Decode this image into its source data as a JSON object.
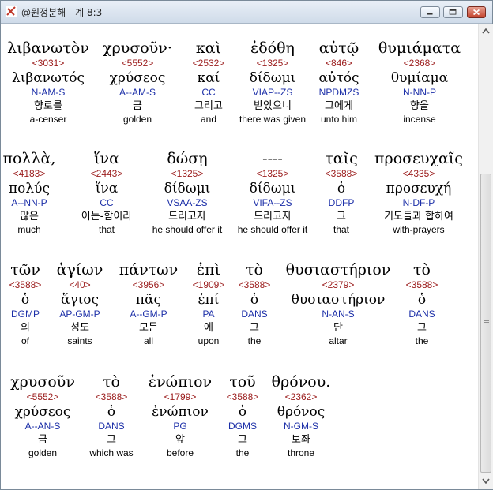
{
  "window": {
    "title": "@원정분해 - 계 8:3",
    "buttons": [
      "minimize",
      "maximize",
      "close"
    ]
  },
  "verse": {
    "rows": [
      [
        {
          "greek": "λιβανωτὸν",
          "strong": "<3031>",
          "lemma": "λιβανωτός",
          "parsing": "N-AM-S",
          "korean": "향로를",
          "english": "a-censer"
        },
        {
          "greek": "χρυσοῦν·",
          "strong": "<5552>",
          "lemma": "χρύσεος",
          "parsing": "A--AM-S",
          "korean": "금",
          "english": "golden"
        },
        {
          "greek": "καὶ",
          "strong": "<2532>",
          "lemma": "καί",
          "parsing": "CC",
          "korean": "그리고",
          "english": "and"
        },
        {
          "greek": "ἐδόθη",
          "strong": "<1325>",
          "lemma": "δίδωμι",
          "parsing": "VIAP--ZS",
          "korean": "받았으니",
          "english": "there was given"
        },
        {
          "greek": "αὐτῷ",
          "strong": "<846>",
          "lemma": "αὐτός",
          "parsing": "NPDMZS",
          "korean": "그에게",
          "english": "unto him"
        },
        {
          "greek": "θυμιάματα",
          "strong": "<2368>",
          "lemma": "θυμίαμα",
          "parsing": "N-NN-P",
          "korean": "향을",
          "english": "incense"
        }
      ],
      [
        {
          "greek": "πολλὰ,",
          "strong": "<4183>",
          "lemma": "πολύς",
          "parsing": "A--NN-P",
          "korean": "많은",
          "english": "much"
        },
        {
          "greek": "ἵνα",
          "strong": "<2443>",
          "lemma": "ἵνα",
          "parsing": "CC",
          "korean": "이는-함이라",
          "english": "that"
        },
        {
          "greek": "δώσῃ",
          "strong": "<1325>",
          "lemma": "δίδωμι",
          "parsing": "VSAA-ZS",
          "korean": "드리고자",
          "english": "he should offer it"
        },
        {
          "greek": "----",
          "strong": "<1325>",
          "lemma": "δίδωμι",
          "parsing": "VIFA--ZS",
          "korean": "드리고자",
          "english": "he should offer it"
        },
        {
          "greek": "ταῖς",
          "strong": "<3588>",
          "lemma": "ὁ",
          "parsing": "DDFP",
          "korean": "그",
          "english": "that"
        },
        {
          "greek": "προσευχαῖς",
          "strong": "<4335>",
          "lemma": "προσευχή",
          "parsing": "N-DF-P",
          "korean": "기도들과 합하여",
          "english": "with-prayers"
        }
      ],
      [
        {
          "greek": "τῶν",
          "strong": "<3588>",
          "lemma": "ὁ",
          "parsing": "DGMP",
          "korean": "의",
          "english": "of"
        },
        {
          "greek": "ἁγίων",
          "strong": "<40>",
          "lemma": "ἅγιος",
          "parsing": "AP-GM-P",
          "korean": "성도",
          "english": "saints"
        },
        {
          "greek": "πάντων",
          "strong": "<3956>",
          "lemma": "πᾶς",
          "parsing": "A--GM-P",
          "korean": "모든",
          "english": "all"
        },
        {
          "greek": "ἐπὶ",
          "strong": "<1909>",
          "lemma": "ἐπί",
          "parsing": "PA",
          "korean": "에",
          "english": "upon"
        },
        {
          "greek": "τὸ",
          "strong": "<3588>",
          "lemma": "ὁ",
          "parsing": "DANS",
          "korean": "그",
          "english": "the"
        },
        {
          "greek": "θυσιαστήριον",
          "strong": "<2379>",
          "lemma": "θυσιαστήριον",
          "parsing": "N-AN-S",
          "korean": "단",
          "english": "altar"
        },
        {
          "greek": "τὸ",
          "strong": "<3588>",
          "lemma": "ὁ",
          "parsing": "DANS",
          "korean": "그",
          "english": "the"
        }
      ],
      [
        {
          "greek": "χρυσοῦν",
          "strong": "<5552>",
          "lemma": "χρύσεος",
          "parsing": "A--AN-S",
          "korean": "금",
          "english": "golden"
        },
        {
          "greek": "τὸ",
          "strong": "<3588>",
          "lemma": "ὁ",
          "parsing": "DANS",
          "korean": "그",
          "english": "which was"
        },
        {
          "greek": "ἐνώπιον",
          "strong": "<1799>",
          "lemma": "ἐνώπιον",
          "parsing": "PG",
          "korean": "앞",
          "english": "before"
        },
        {
          "greek": "τοῦ",
          "strong": "<3588>",
          "lemma": "ὁ",
          "parsing": "DGMS",
          "korean": "그",
          "english": "the"
        },
        {
          "greek": "θρόνου.",
          "strong": "<2362>",
          "lemma": "θρόνος",
          "parsing": "N-GM-S",
          "korean": "보좌",
          "english": "throne"
        }
      ]
    ]
  }
}
